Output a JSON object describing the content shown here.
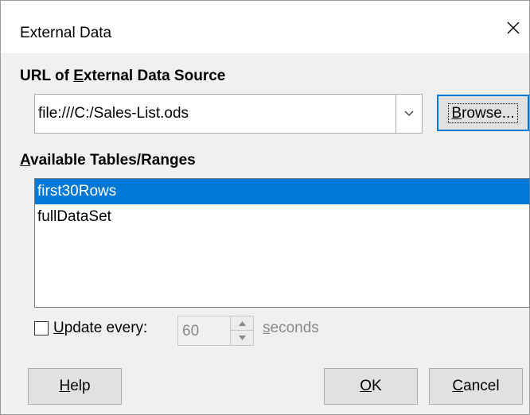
{
  "window": {
    "title": "External Data",
    "close_icon": "close-icon"
  },
  "url_section": {
    "label_pre": "URL of ",
    "label_mnemonic": "E",
    "label_post": "xternal Data Source",
    "combo_value": "file:///C:/Sales-List.ods",
    "dropdown_icon": "chevron-down-icon",
    "browse_mnemonic": "B",
    "browse_rest": "rowse..."
  },
  "tables_section": {
    "label_mnemonic": "A",
    "label_rest": "vailable Tables/Ranges",
    "items": [
      {
        "label": "first30Rows",
        "selected": true
      },
      {
        "label": "fullDataSet",
        "selected": false
      }
    ]
  },
  "update": {
    "checked": false,
    "label_mnemonic": "U",
    "label_rest": "pdate every:",
    "interval_value": "60",
    "units_mnemonic": "s",
    "units_rest": "econds"
  },
  "buttons": {
    "help_mnemonic": "H",
    "help_rest": "elp",
    "ok_mnemonic": "O",
    "ok_rest": "K",
    "cancel_mnemonic": "C",
    "cancel_rest": "ancel"
  },
  "colors": {
    "selection": "#0078d7",
    "dialog_bg": "#f0f0f0",
    "focus_border": "#0078d7"
  }
}
